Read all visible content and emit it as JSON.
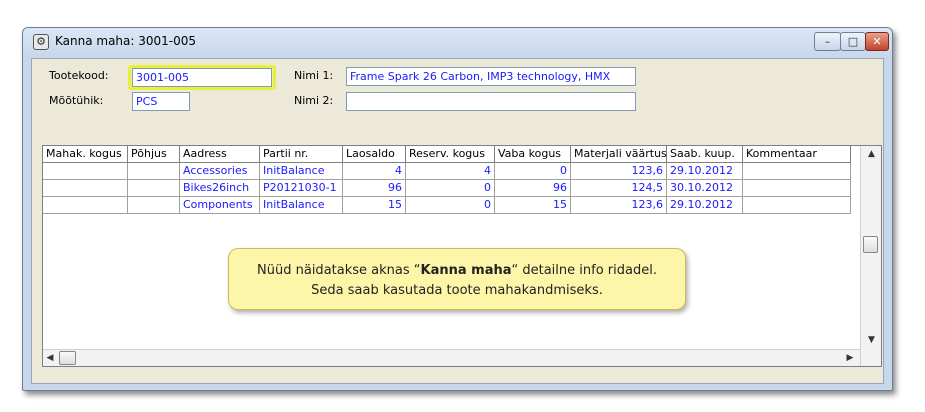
{
  "window": {
    "title": "Kanna maha: 3001-005",
    "minimize_glyph": "–",
    "maximize_glyph": "□",
    "close_glyph": "✕"
  },
  "form": {
    "tootekood_label": "Tootekood:",
    "tootekood_value": "3001-005",
    "mootuhik_label": "Mõõtühik:",
    "mootuhik_value": "PCS",
    "nimi1_label": "Nimi 1:",
    "nimi1_value": "Frame Spark 26 Carbon, IMP3 technology, HMX",
    "nimi2_label": "Nimi 2:",
    "nimi2_value": ""
  },
  "table": {
    "columns": [
      "Mahak. kogus",
      "Põhjus",
      "Aadress",
      "Partii nr.",
      "Laosaldo",
      "Reserv. kogus",
      "Vaba kogus",
      "Materjali väärtus",
      "Saab. kuup.",
      "Kommentaar"
    ],
    "rows": [
      [
        "",
        "",
        "Accessories",
        "InitBalance",
        "4",
        "4",
        "0",
        "123,6",
        "29.10.2012",
        ""
      ],
      [
        "",
        "",
        "Bikes26inch",
        "P20121030-1",
        "96",
        "0",
        "96",
        "124,5",
        "30.10.2012",
        ""
      ],
      [
        "",
        "",
        "Components",
        "InitBalance",
        "15",
        "0",
        "15",
        "123,6",
        "29.10.2012",
        ""
      ]
    ]
  },
  "callout": {
    "line1_before": "Nüüd näidatakse aknas “",
    "line1_bold": "Kanna maha",
    "line1_after": "“ detailne info ridadel.",
    "line2": "Seda saab kasutada toote mahakandmiseks."
  },
  "icons": {
    "title": "gear-icon",
    "scroll_up": "arrow-up-icon",
    "scroll_down": "arrow-down-icon",
    "scroll_left": "arrow-left-icon",
    "scroll_right": "arrow-right-icon"
  },
  "colors": {
    "field_text": "#1a1aff",
    "highlight": "#e8f03a",
    "callout_bg": "#fdf6a8"
  }
}
